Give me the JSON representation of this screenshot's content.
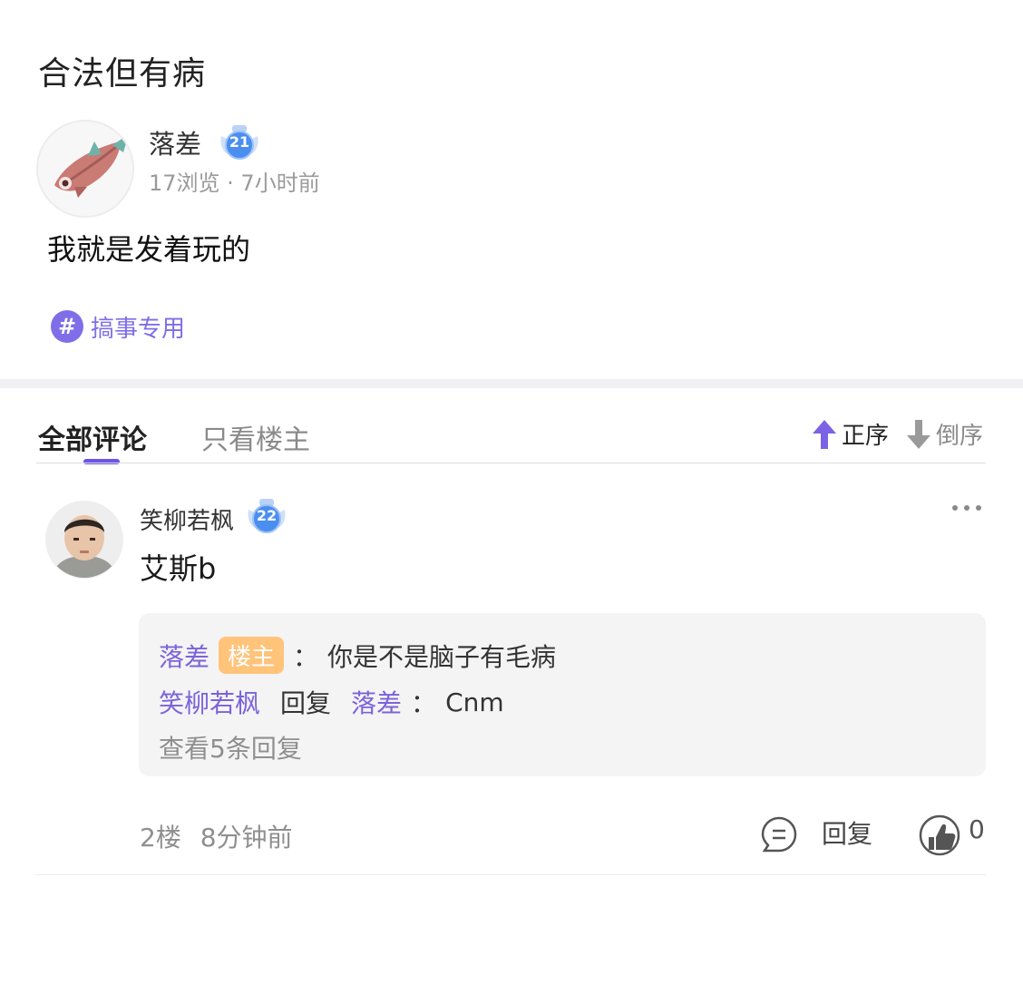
{
  "post": {
    "title": "合法但有病",
    "author": {
      "name": "落差",
      "level": "21"
    },
    "meta": "17浏览 · 7小时前",
    "body": "我就是发着玩的",
    "topic": {
      "icon": "#",
      "label": "搞事专用"
    }
  },
  "tabs": {
    "all": "全部评论",
    "op_only": "只看楼主",
    "sort_asc": "正序",
    "sort_desc": "倒序"
  },
  "comment": {
    "author": "笑柳若枫",
    "level": "22",
    "text": "艾斯b",
    "replies": [
      {
        "user": "落差",
        "badge": "楼主",
        "separator": "：",
        "text": "你是不是脑子有毛病"
      },
      {
        "user": "笑柳若枫",
        "verb": "回复",
        "target": "落差",
        "separator": "：",
        "text": "Cnm"
      }
    ],
    "view_more": "查看5条回复",
    "floor": "2楼",
    "time": "8分钟前",
    "reply_label": "回复",
    "like_count": "0"
  },
  "colors": {
    "accent": "#6b54e6",
    "username": "#7b63d9",
    "op_badge": "#ffc37a"
  }
}
